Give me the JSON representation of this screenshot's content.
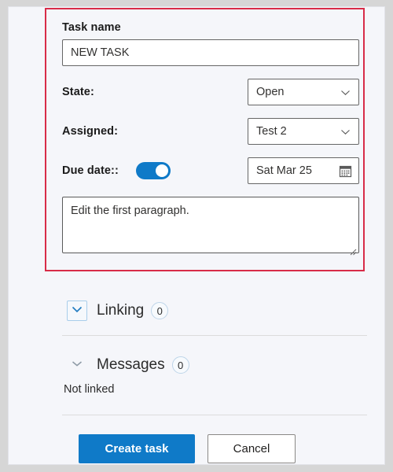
{
  "colors": {
    "accent": "#0f7ac8",
    "highlight_border": "#d82c48",
    "panel_bg": "#f5f6fa",
    "frame_bg": "#d6d6d6"
  },
  "form": {
    "task_name": {
      "label": "Task name",
      "value": "NEW TASK",
      "placeholder": "Task name"
    },
    "state": {
      "label": "State:",
      "value": "Open",
      "chevron_icon": "chevron-down-icon"
    },
    "assigned": {
      "label": "Assigned:",
      "value": "Test 2",
      "chevron_icon": "chevron-down-icon"
    },
    "due_date": {
      "label": "Due date::",
      "toggle_on": true,
      "value": "Sat Mar 25",
      "calendar_icon": "calendar-icon"
    },
    "notes": {
      "value": "Edit the first paragraph.",
      "placeholder": "Notes"
    }
  },
  "sections": {
    "linking": {
      "title": "Linking",
      "count": "0",
      "chevron_icon": "chevron-down-icon",
      "expanded": false
    },
    "messages": {
      "title": "Messages",
      "count": "0",
      "chevron_icon": "chevron-down-icon",
      "expanded": false
    },
    "link_status": "Not linked"
  },
  "buttons": {
    "primary": "Create task",
    "secondary": "Cancel"
  }
}
